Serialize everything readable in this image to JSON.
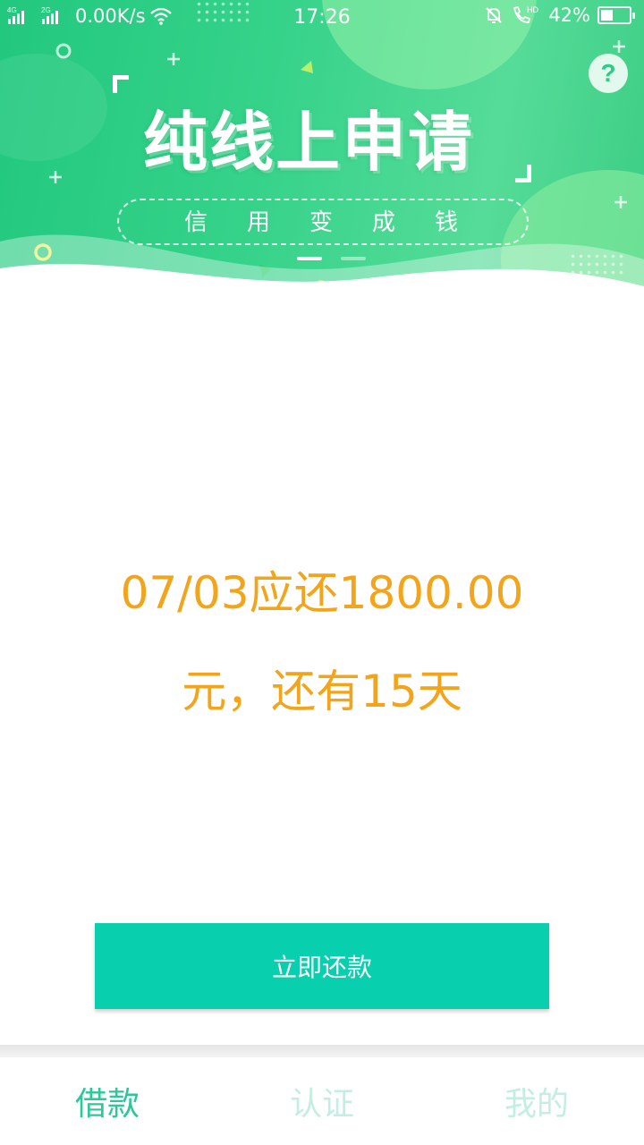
{
  "status_bar": {
    "signal_1": "4G",
    "signal_2": "2G",
    "speed": "0.00K/s",
    "time": "17:26",
    "hd_label": "HD",
    "battery_text": "42%",
    "battery_level_percent": 42
  },
  "banner": {
    "title": "纯线上申请",
    "subtitle": "信用变成钱",
    "slide_count": 2,
    "active_slide": 1
  },
  "help": {
    "label": "?"
  },
  "repay": {
    "line1": "07/03应还1800.00",
    "line2": "元，还有15天",
    "button_label": "立即还款"
  },
  "nav": {
    "items": [
      {
        "label": "借款",
        "active": true
      },
      {
        "label": "认证",
        "active": false
      },
      {
        "label": "我的",
        "active": false
      }
    ]
  },
  "colors": {
    "banner_green": "#2ccb86",
    "amount_orange": "#f2a51a",
    "button_teal": "#08cfae",
    "nav_active": "#2cc79a",
    "nav_inactive": "#c4eee2"
  }
}
